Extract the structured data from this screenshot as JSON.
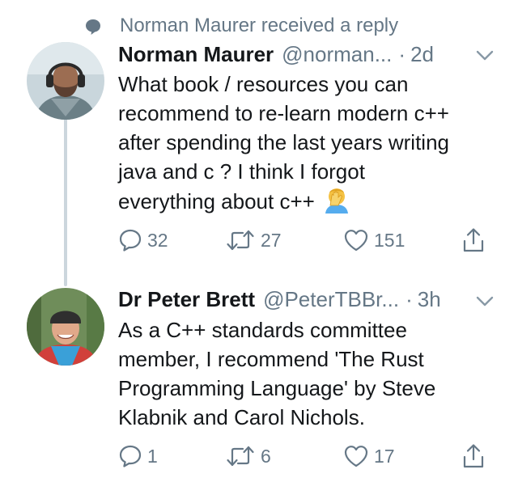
{
  "context": {
    "icon": "speech-bubble-icon",
    "text": "Norman Maurer received a reply"
  },
  "tweets": [
    {
      "name": "Norman Maurer",
      "handle": "@norman...",
      "dot": "·",
      "time": "2d",
      "lines": [
        "What book / resources you can",
        "recommend to re-learn modern c++",
        "after spending the last years writing",
        "java and c ? I think I forgot",
        "everything about c++"
      ],
      "emoji": "face-palm-emoji",
      "replies": "32",
      "retweets": "27",
      "likes": "151"
    },
    {
      "name": "Dr Peter Brett",
      "handle": "@PeterTBBr...",
      "dot": "·",
      "time": "3h",
      "lines": [
        "As a C++ standards committee",
        "member, I recommend 'The Rust",
        "Programming Language' by Steve",
        "Klabnik and Carol Nichols."
      ],
      "replies": "1",
      "retweets": "6",
      "likes": "17"
    }
  ],
  "colors": {
    "text": "#14171a",
    "muted": "#657786",
    "thread_line": "#ccd6dd",
    "icon": "#657786"
  },
  "icons": [
    "reply-icon",
    "retweet-icon",
    "like-icon",
    "share-icon",
    "chevron-down-icon"
  ]
}
